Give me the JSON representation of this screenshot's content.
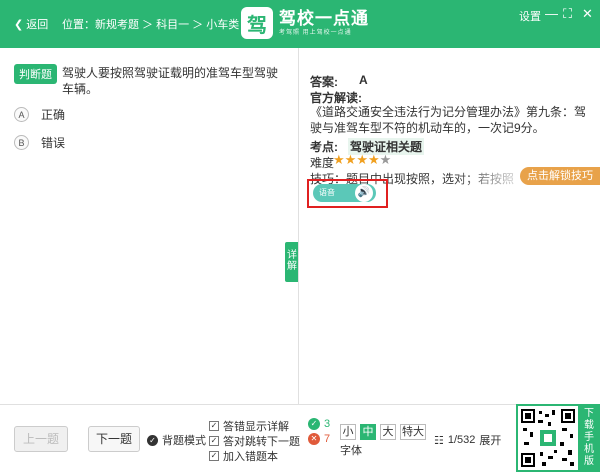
{
  "header": {
    "back_label": "返回",
    "breadcrumb": "位置：新规考题 ＞ 科目一 ＞ 小车类",
    "logo_char": "驾",
    "logo_title": "驾校一点通",
    "logo_subtitle": "考驾照  用上驾校一点通",
    "settings_label": "设置",
    "minimize": "—",
    "fullscreen": "⛶",
    "close": "✕"
  },
  "question": {
    "type_badge": "判断题",
    "text": "驾驶人要按照驾驶证载明的准驾车型驾驶车辆。",
    "options": [
      {
        "letter": "A",
        "label": "正确"
      },
      {
        "letter": "B",
        "label": "错误"
      }
    ],
    "detail_tab": "详解"
  },
  "answer": {
    "answer_label": "答案:",
    "answer_value": "A",
    "explain_label": "官方解读:",
    "explain_text": "《道路交通安全违法行为记分管理办法》第九条：驾驶与准驾车型不符的机动车的，一次记9分。",
    "point_label": "考点:",
    "point_value": "驾驶证相关题",
    "difficulty_label": "难度",
    "difficulty_stars": 4,
    "difficulty_max": 5,
    "tip_text": "技巧：题目中出现按照，选对；若按照",
    "tip_button": "点击解锁技巧",
    "voice_label": "语音"
  },
  "footer": {
    "prev_label": "上一题",
    "next_label": "下一题",
    "recite_mode": "背题模式",
    "chk_show_detail": "答错显示详解",
    "chk_auto_next": "答对跳转下一题",
    "chk_add_wrong": "加入错题本",
    "correct_count": "3",
    "wrong_count": "7",
    "font_small": "小",
    "font_medium": "中",
    "font_large": "大",
    "font_xlarge": "特大",
    "font_label": "字体",
    "progress": "1/532",
    "expand_label": "展开",
    "qr_label": "下载手机版"
  },
  "colors": {
    "brand": "#2bb673",
    "accent_orange": "#e8a24a",
    "highlight_red": "#e02020",
    "star": "#f0a020"
  }
}
